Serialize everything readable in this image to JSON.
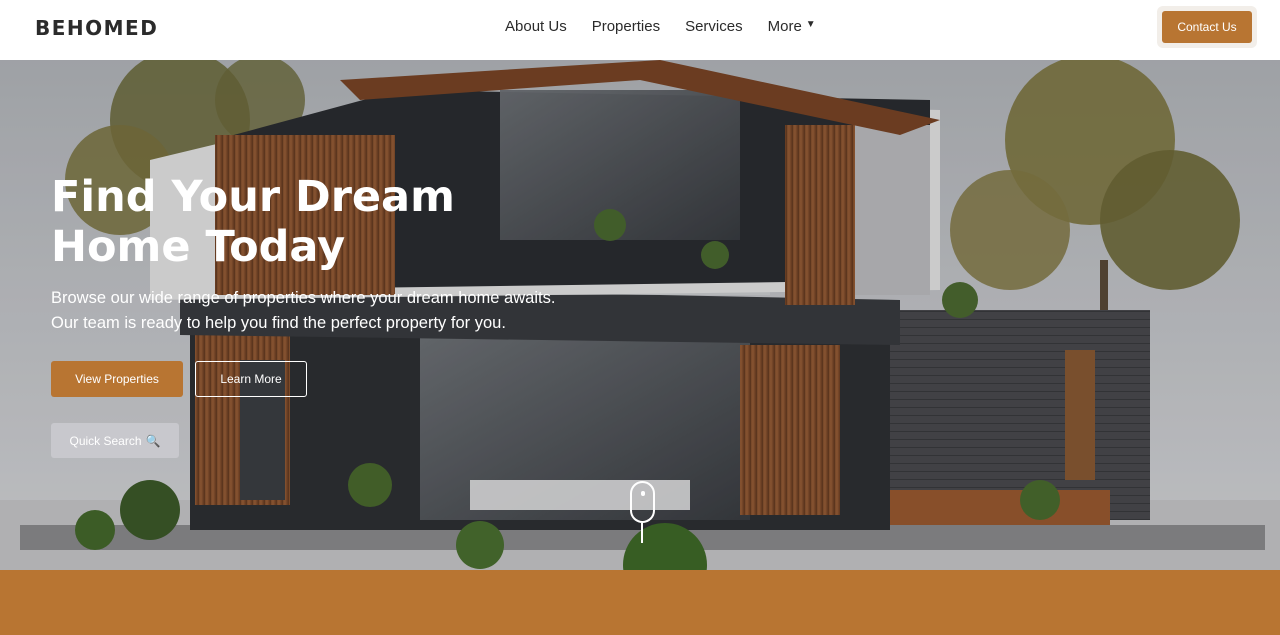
{
  "header": {
    "logo": "BEHOMED",
    "nav": [
      {
        "label": "About Us"
      },
      {
        "label": "Properties"
      },
      {
        "label": "Services"
      },
      {
        "label": "More",
        "caret": "▼"
      }
    ],
    "contact_label": "Contact Us"
  },
  "hero": {
    "title": "Find Your Dream Home Today",
    "subtitle": "Browse our wide range of properties where your dream home awaits. Our team is ready to help you find the perfect property for you.",
    "primary_button": "View Properties",
    "secondary_button": "Learn More",
    "search_button": "Quick Search",
    "search_icon": "🔍"
  },
  "colors": {
    "accent": "#b87532",
    "header_bg": "#ffffff",
    "text_dark": "#2b2b2b"
  }
}
